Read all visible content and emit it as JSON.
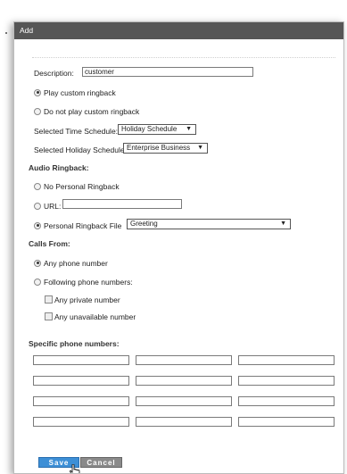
{
  "dialog": {
    "title": "Add"
  },
  "description": {
    "label": "Description:",
    "value": "customer"
  },
  "ringback": {
    "play": "Play custom ringback",
    "no_play": "Do not play custom ringback",
    "play_selected": true
  },
  "time_schedule": {
    "label": "Selected Time Schedule:",
    "value": "Holiday Schedule"
  },
  "holiday_schedule": {
    "label": "Selected Holiday Schedule:",
    "value": "Enterprise Business"
  },
  "audio": {
    "heading": "Audio Ringback:",
    "none": "No Personal Ringback",
    "url_label": "URL:",
    "url_value": "",
    "file_label": "Personal Ringback File",
    "file_value": "Greeting",
    "selected": "file"
  },
  "calls_from": {
    "heading": "Calls From:",
    "any": "Any phone number",
    "following": "Following phone numbers:",
    "private": "Any private number",
    "unavailable": "Any unavailable number",
    "selected": "any"
  },
  "specific": {
    "heading": "Specific phone numbers:",
    "rows": 4,
    "cols": 3
  },
  "buttons": {
    "save": "Save",
    "cancel": "Cancel"
  },
  "icons": {
    "dropdown": "chevron-down-icon",
    "pointer": "hand-cursor-icon"
  },
  "colors": {
    "titlebar": "#565656",
    "save": "#3d8fd6",
    "cancel": "#8a8a8a"
  }
}
